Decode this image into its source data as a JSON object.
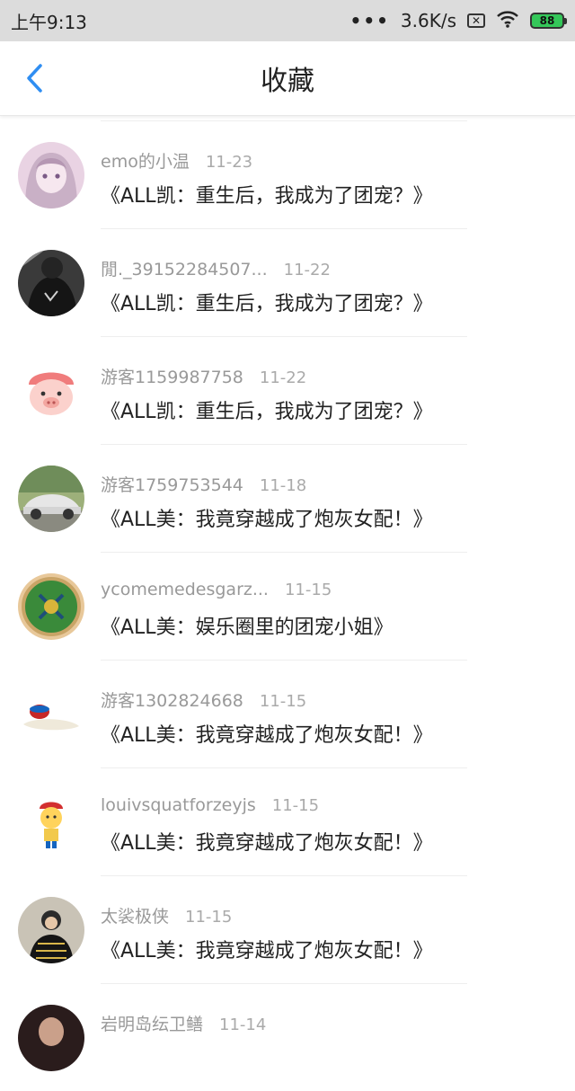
{
  "status_bar": {
    "time": "上午9:13",
    "dots": "•••",
    "network_speed": "3.6K/s",
    "sim_icon": "x-box-icon",
    "wifi_icon": "wifi-icon",
    "battery_level": "88"
  },
  "header": {
    "title": "收藏",
    "back_icon": "chevron-left-icon",
    "accent_color": "#2f8ef2"
  },
  "items": [
    {
      "user": "emo的小温",
      "date": "11-23",
      "book": "《ALL凯：重生后，我成为了团宠？》",
      "avatar": "anime-girl-avatar"
    },
    {
      "user": "閒._39152284507...",
      "date": "11-22",
      "book": "《ALL凯：重生后，我成为了团宠？》",
      "avatar": "dark-photo-avatar"
    },
    {
      "user": "游客1159987758",
      "date": "11-22",
      "book": "《ALL凯：重生后，我成为了团宠？》",
      "avatar": "pig-avatar"
    },
    {
      "user": "游客1759753544",
      "date": "11-18",
      "book": "《ALL美：我竟穿越成了炮灰女配！》",
      "avatar": "car-avatar"
    },
    {
      "user": "ycomemedesgarz...",
      "date": "11-15",
      "book": "《ALL美：娱乐圈里的团宠小姐》",
      "avatar": "emblem-avatar"
    },
    {
      "user": "游客1302824668",
      "date": "11-15",
      "book": "《ALL美：我竟穿越成了炮灰女配！》",
      "avatar": "food-avatar"
    },
    {
      "user": "louivsquatforzeyjs",
      "date": "11-15",
      "book": "《ALL美：我竟穿越成了炮灰女配！》",
      "avatar": "cartoon-kid-avatar"
    },
    {
      "user": "太裟极侠",
      "date": "11-15",
      "book": "《ALL美：我竟穿越成了炮灰女配！》",
      "avatar": "person-photo-avatar"
    },
    {
      "user": "岩明岛纭卫鳝",
      "date": "11-14",
      "book": "",
      "avatar": "partial-avatar"
    }
  ]
}
